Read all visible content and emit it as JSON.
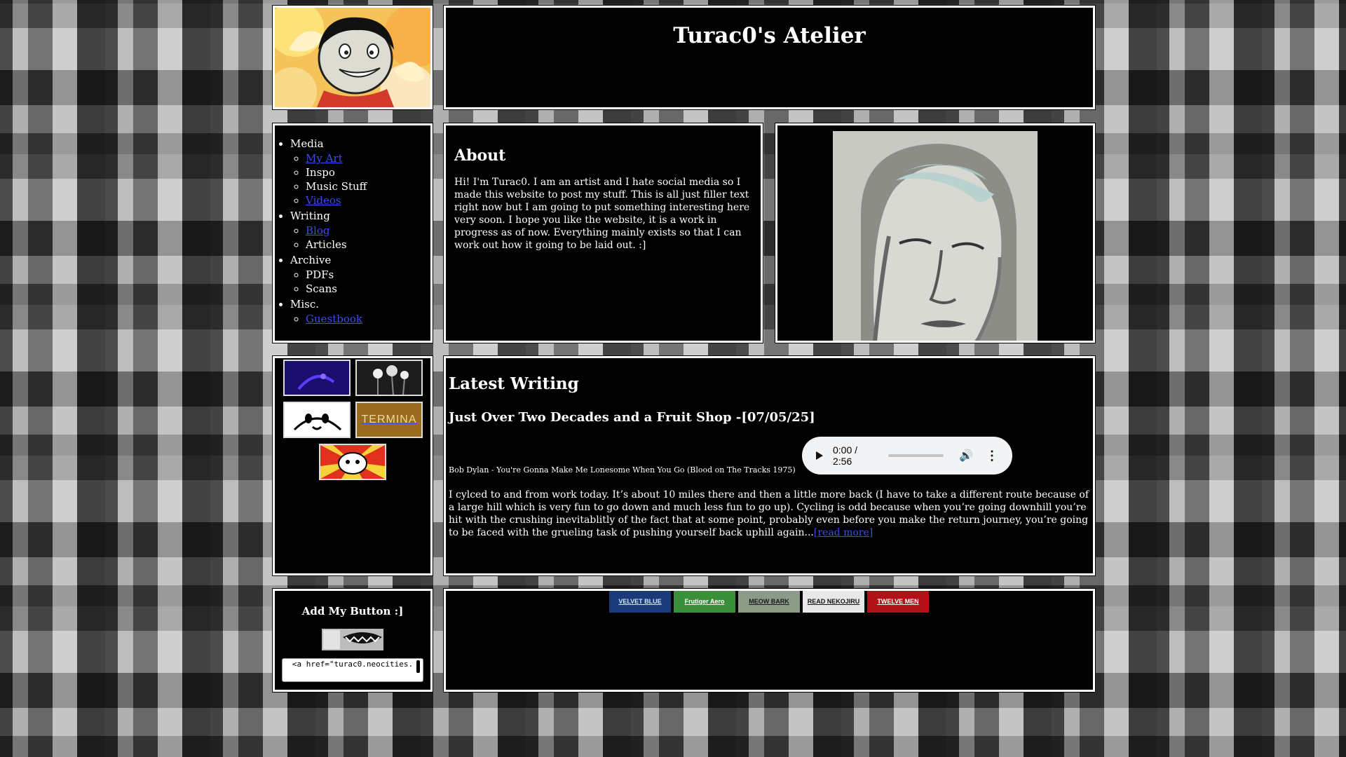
{
  "site": {
    "title": "Turac0's Atelier"
  },
  "nav": {
    "sections": [
      {
        "label": "Media",
        "items": [
          {
            "label": "My Art",
            "link": true
          },
          {
            "label": "Inspo",
            "link": false
          },
          {
            "label": "Music Stuff",
            "link": false
          },
          {
            "label": "Videos",
            "link": true
          }
        ]
      },
      {
        "label": "Writing",
        "items": [
          {
            "label": "Blog",
            "link": true
          },
          {
            "label": "Articles",
            "link": false
          }
        ]
      },
      {
        "label": "Archive",
        "items": [
          {
            "label": "PDFs",
            "link": false
          },
          {
            "label": "Scans",
            "link": false
          }
        ]
      },
      {
        "label": "Misc.",
        "items": [
          {
            "label": "Guestbook",
            "link": true
          }
        ]
      }
    ]
  },
  "about": {
    "heading": "About",
    "text": "Hi! I'm Turac0. I am an artist and I hate social media so I made this website to post my stuff. This is all just filler text right now but I am going to put something interesting here very soon. I hope you like the website, it is a work in progress as of now. Everything mainly exists so that I can work out how it going to be laid out. :]"
  },
  "latest": {
    "heading": "Latest Writing",
    "post_title": "Just Over Two Decades and a Fruit Shop -[07/05/25]",
    "song_caption": "Bob Dylan - You're Gonna Make Me Lonesome When You Go (Blood on The Tracks 1975)",
    "audio_time": "0:00 / 2:56",
    "audio_progress": 0,
    "excerpt": "I cylced to and from work today. It’s about 10 miles there and then a little more back (I have to take a different route because of a large hill which is very fun to go down and much less fun to go up). Cycling is odd because when you’re going downhill you’re hit with the crushing inevitablitly of the fact that at some point, probably even before you make the return journey, you’re going to be faced with the grueling task of pushing yourself back uphill again...",
    "read_more": "[read more]"
  },
  "add_button": {
    "heading": "Add My Button :]",
    "embed_code": "<a href=\"turac0.neocities."
  },
  "webring": [
    {
      "label": "VELVET BLUE",
      "bg": "#1a3a7a",
      "fg": "#cfe6ff"
    },
    {
      "label": "Frutiger Aero Archive",
      "bg": "#3c8f3a",
      "fg": "#ffffff"
    },
    {
      "label": "MEOW BARK",
      "bg": "#8c9a88",
      "fg": "#1a1a1a"
    },
    {
      "label": "READ NEKOJIRU",
      "bg": "#e8e8e8",
      "fg": "#111111"
    },
    {
      "label": "TWELVE MEN",
      "bg": "#b01218",
      "fg": "#ffffff"
    }
  ],
  "side_buttons": [
    {
      "name": "purple-night-button",
      "bg": "#1b0f6e"
    },
    {
      "name": "white-flowers-button",
      "bg": "#2a2a2a"
    },
    {
      "name": "cat-face-button",
      "bg": "#ffffff"
    },
    {
      "name": "termina-button",
      "label": "TERMINA",
      "bg": "#9a6b1f"
    },
    {
      "name": "sunburst-cat-button",
      "bg": "#e0301e"
    }
  ]
}
